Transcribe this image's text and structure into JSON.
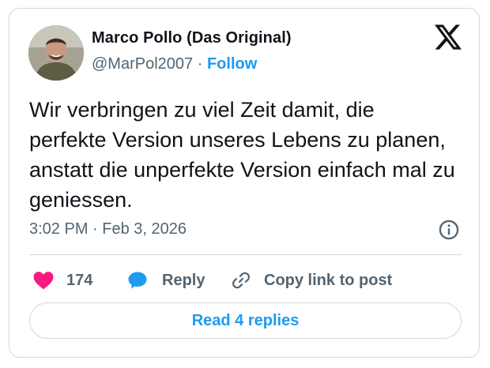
{
  "tweet": {
    "author_name": "Marco Pollo (Das Original)",
    "handle": "@MarPol2007",
    "separator": "·",
    "follow_label": "Follow",
    "text": "Wir verbringen zu viel Zeit damit, die perfekte Version unseres Lebens zu planen, anstatt die unperfekte Version einfach mal zu geniessen.",
    "timestamp": "3:02 PM · Feb 3, 2026"
  },
  "actions": {
    "like_count": "174",
    "reply_label": "Reply",
    "copy_link_label": "Copy link to post"
  },
  "footer": {
    "read_replies_label": "Read 4 replies"
  },
  "colors": {
    "accent": "#1d9bf0",
    "like": "#f91880",
    "text": "#0f1419",
    "muted": "#536471",
    "border": "#cfd9de"
  },
  "icons": {
    "brand": "x-logo-icon",
    "info": "info-icon",
    "like": "heart-icon",
    "reply": "speech-bubble-icon",
    "copy": "link-icon"
  }
}
